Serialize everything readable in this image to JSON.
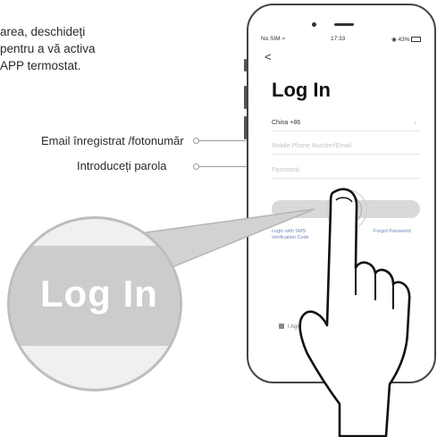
{
  "intro": {
    "line1": "area, deschideți",
    "line2": "pentru a vă activa",
    "line3": "APP termostat."
  },
  "callouts": {
    "email": "Email înregistrat /fotonumăr",
    "password": "Introduceți parola"
  },
  "phone": {
    "status": {
      "carrier": "No SIM",
      "time": "17:33",
      "battery": "43%"
    },
    "back": "<",
    "title": "Log In",
    "country": "China +86",
    "phone_placeholder": "Mobile Phone Number/Email",
    "password_placeholder": "Password",
    "login_button": "Log In",
    "sms_login": "Login with SMS Verification Code",
    "forgot_password": "Forgot Password",
    "agree": "I Agree"
  },
  "magnifier": {
    "text": "Log In"
  }
}
